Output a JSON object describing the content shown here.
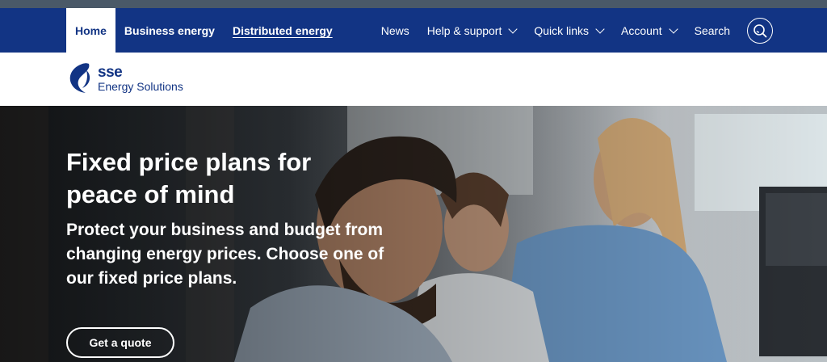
{
  "nav": {
    "primary": [
      {
        "label": "Home",
        "active": true
      },
      {
        "label": "Business energy"
      },
      {
        "label": "Distributed energy"
      }
    ],
    "secondary": [
      {
        "label": "News"
      },
      {
        "label": "Help & support"
      },
      {
        "label": "Quick links"
      },
      {
        "label": "Account"
      },
      {
        "label": "Search"
      }
    ],
    "search_icon": "search-icon"
  },
  "brand": {
    "name": "sse",
    "subtitle": "Energy Solutions",
    "color": "#123484"
  },
  "hero": {
    "title": "Fixed price plans for peace of mind",
    "subtitle": "Protect your business and budget from changing energy prices. Choose one of our fixed price plans.",
    "cta_label": "Get a quote"
  },
  "colors": {
    "nav_background": "#123484",
    "top_strip": "#4a5968"
  }
}
